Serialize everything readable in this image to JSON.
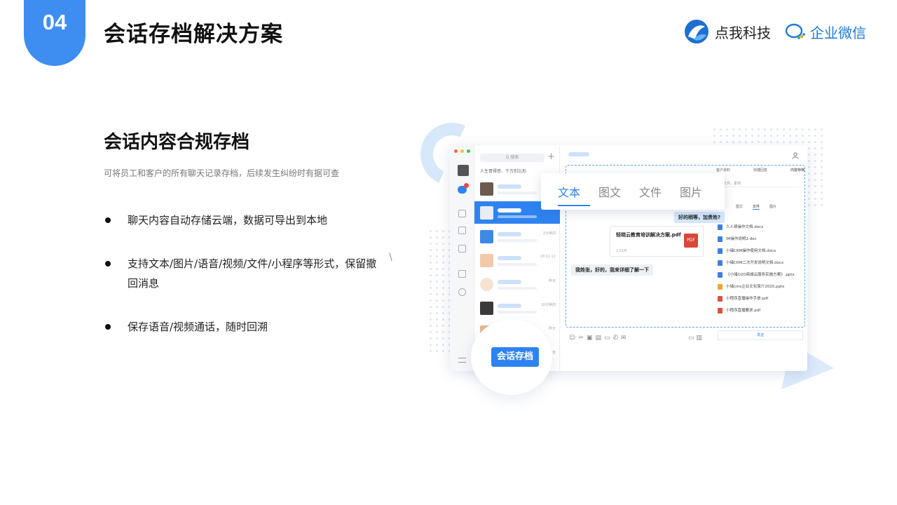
{
  "header": {
    "section_number": "04",
    "title": "会话存档解决方案",
    "brand_name": "点我科技",
    "partner_name": "企业微信"
  },
  "content": {
    "heading": "会话内容合规存档",
    "description": "可将员工和客户的所有聊天记录存档，后续发生纠纷时有据可查",
    "features": [
      {
        "text": "聊天内容自动存储云端，数据可导出到本地"
      },
      {
        "text": "支持文本/图片/语音/视频/文件/小程序等形式，保留撤回消息"
      },
      {
        "text": "保存语音/视频通话，随时回溯"
      }
    ]
  },
  "illustration": {
    "search_placeholder": "Q 搜索",
    "plus": "+",
    "pinned_text": "人生胃得意、千万别忘形",
    "chat_times": [
      "",
      "",
      "2分钟前",
      "19:11:12",
      "昨天",
      "10分钟前",
      "昨天",
      "昨天"
    ],
    "type_tabs": [
      "文本",
      "图文",
      "文件",
      "图片"
    ],
    "message_right": "好的稍等，加贵姓?",
    "file_card": {
      "name": "轻晓云教育培训解决方案.pdf",
      "size": "2.51M",
      "badge": "PDF"
    },
    "message_left": "我姓张，好的，我来详细了解一下",
    "files_panel": {
      "head": [
        "客户资料",
        "快捷回复",
        "内容存档"
      ],
      "search_hint": "搜索文件、素材",
      "tabs": [
        "图文",
        "文件",
        "图片"
      ],
      "items": [
        "人人顿操作文档.docx",
        "IM操作说明2.doc",
        "小储CRM操作使用文档.docx",
        "小储CRM二次开发说明文档.docx",
        "《小储O2O商城云服务实施方案》.pptx",
        "小储cms企业文化简介2020.pptx",
        "小程序直播操作手册.pdf",
        "小程序直播要求.pdf"
      ],
      "confirm": "发送"
    },
    "archive_label": "会话存档"
  },
  "colors": {
    "accent": "#3e8ef1",
    "brand_blue": "#2f83f0",
    "title": "#111111",
    "desc": "#777777"
  }
}
